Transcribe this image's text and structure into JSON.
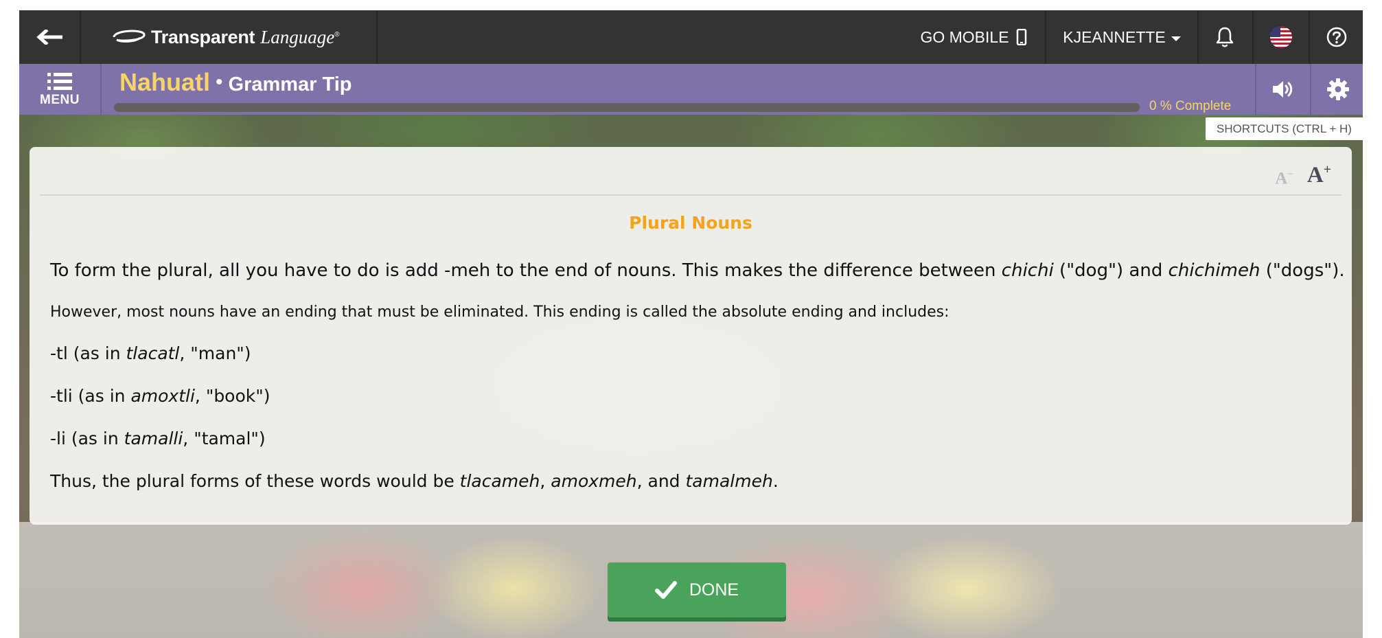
{
  "topbar": {
    "logo_bold": "Transparent",
    "logo_italic": "Language",
    "logo_reg": "®",
    "go_mobile": "GO MOBILE",
    "user": "KJEANNETTE"
  },
  "lesson": {
    "menu_label": "MENU",
    "language": "Nahuatl",
    "separator": "•",
    "activity": "Grammar Tip",
    "progress_percent": 0,
    "progress_text": "0 % Complete",
    "shortcuts": "SHORTCUTS (CTRL + H)"
  },
  "font_controls": {
    "decrease": "A",
    "decrease_sup": "−",
    "increase": "A",
    "increase_sup": "+"
  },
  "tip": {
    "heading": "Plural Nouns",
    "p1": [
      "To form the plural, all you have to do is add -meh to the end of nouns. This makes the difference between ",
      "chichi",
      " (\"dog\") and ",
      "chichimeh",
      " (\"dogs\")."
    ],
    "p2": "However, most nouns have an ending that must be eliminated. This ending is called the absolute ending and includes:",
    "p3": [
      "-tl (as in ",
      "tlacatl",
      ", \"man\")"
    ],
    "p4": [
      "-tli (as in ",
      "amoxtli",
      ", \"book\")"
    ],
    "p5": [
      "-li (as in ",
      "tamalli",
      ", \"tamal\")"
    ],
    "p6": [
      "Thus, the plural forms of these words would be ",
      "tlacameh",
      ", ",
      "amoxmeh",
      ", and ",
      "tamalmeh",
      "."
    ]
  },
  "done_button": "DONE",
  "colors": {
    "topbar": "#333333",
    "lessonbar": "#7e72a8",
    "language": "#f6d46a",
    "heading": "#f5a31b",
    "done": "#4aa35b"
  }
}
